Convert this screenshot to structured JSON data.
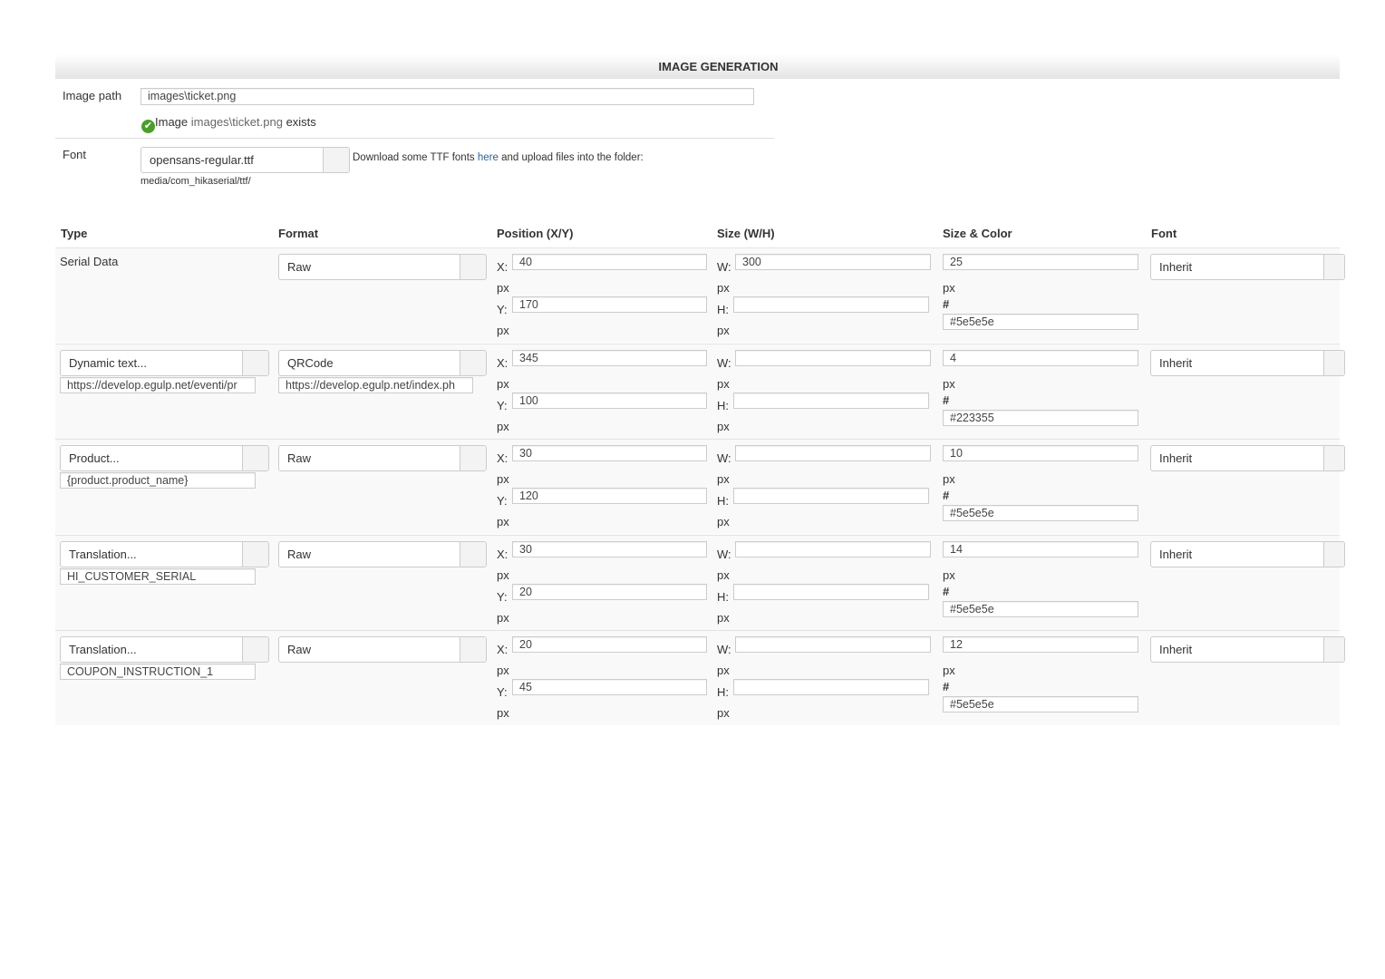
{
  "section_title": "IMAGE GENERATION",
  "image_path": {
    "label": "Image path",
    "value": "images\\ticket.png",
    "status_prefix": "Image",
    "status_path": "images\\ticket.png",
    "status_suffix": "exists"
  },
  "font": {
    "label": "Font",
    "value": "opensans-regular.ttf",
    "help_before": "Download some TTF fonts",
    "help_link": "here",
    "help_after": "and upload files into the folder:",
    "folder": "media/com_hikaserial/ttf/"
  },
  "columns": [
    "Type",
    "Format",
    "Position (X/Y)",
    "Size (W/H)",
    "Size & Color",
    "Font"
  ],
  "labels": {
    "x": "X:",
    "y": "Y:",
    "w": "W:",
    "h": "H:",
    "px": "px",
    "hash": "#"
  },
  "rows": [
    {
      "type": "Serial Data",
      "type_select": null,
      "type_value": null,
      "format": "Raw",
      "format_value": null,
      "x": "40",
      "y": "170",
      "w": "300",
      "h": "",
      "size": "25",
      "color": "#5e5e5e",
      "font": "Inherit"
    },
    {
      "type": null,
      "type_select": "Dynamic text...",
      "type_value": "https://develop.egulp.net/eventi/pr",
      "format": "QRCode",
      "format_value": "https://develop.egulp.net/index.ph",
      "x": "345",
      "y": "100",
      "w": "",
      "h": "",
      "size": "4",
      "color": "#223355",
      "font": "Inherit"
    },
    {
      "type": null,
      "type_select": "Product...",
      "type_value": "{product.product_name}",
      "format": "Raw",
      "format_value": null,
      "x": "30",
      "y": "120",
      "w": "",
      "h": "",
      "size": "10",
      "color": "#5e5e5e",
      "font": "Inherit"
    },
    {
      "type": null,
      "type_select": "Translation...",
      "type_value": "HI_CUSTOMER_SERIAL",
      "format": "Raw",
      "format_value": null,
      "x": "30",
      "y": "20",
      "w": "",
      "h": "",
      "size": "14",
      "color": "#5e5e5e",
      "font": "Inherit"
    },
    {
      "type": null,
      "type_select": "Translation...",
      "type_value": "COUPON_INSTRUCTION_1",
      "format": "Raw",
      "format_value": null,
      "x": "20",
      "y": "45",
      "w": "",
      "h": "",
      "size": "12",
      "color": "#5e5e5e",
      "font": "Inherit"
    }
  ]
}
